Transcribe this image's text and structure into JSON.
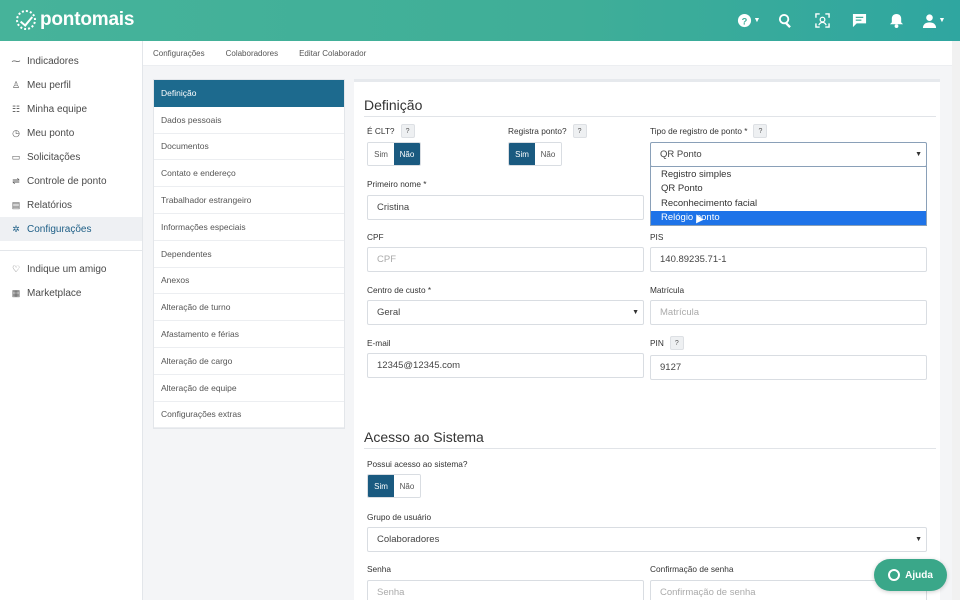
{
  "brand": {
    "name": "pontomais"
  },
  "topbar": {
    "icons": [
      "help-icon",
      "search-icon",
      "face-scan-icon",
      "chat-icon",
      "bell-icon",
      "user-icon"
    ]
  },
  "sidebar": {
    "items": [
      {
        "label": "Indicadores",
        "icon": "chart-icon"
      },
      {
        "label": "Meu perfil",
        "icon": "user-icon"
      },
      {
        "label": "Minha equipe",
        "icon": "team-icon"
      },
      {
        "label": "Meu ponto",
        "icon": "clock-icon"
      },
      {
        "label": "Solicitações",
        "icon": "message-icon"
      },
      {
        "label": "Controle de ponto",
        "icon": "control-icon"
      },
      {
        "label": "Relatórios",
        "icon": "report-icon"
      },
      {
        "label": "Configurações",
        "icon": "gear-icon",
        "active": true
      }
    ],
    "extra": [
      {
        "label": "Indique um amigo",
        "icon": "heart-icon"
      },
      {
        "label": "Marketplace",
        "icon": "store-icon"
      }
    ]
  },
  "breadcrumb": [
    "Configurações",
    "Colaboradores",
    "Editar Colaborador"
  ],
  "submenu": [
    "Definição",
    "Dados pessoais",
    "Documentos",
    "Contato e endereço",
    "Trabalhador estrangeiro",
    "Informações especiais",
    "Dependentes",
    "Anexos",
    "Alteração de turno",
    "Afastamento e férias",
    "Alteração de cargo",
    "Alteração de equipe",
    "Configurações extras"
  ],
  "definicao": {
    "title": "Definição",
    "clt": {
      "label": "É CLT?",
      "help": "?",
      "sim": "Sim",
      "nao": "Não",
      "selected": "Não"
    },
    "registra": {
      "label": "Registra ponto?",
      "help": "?",
      "sim": "Sim",
      "nao": "Não",
      "selected": "Sim"
    },
    "tipo": {
      "label": "Tipo de registro de ponto *",
      "help": "?",
      "value": "QR Ponto",
      "options": [
        "Registro simples",
        "QR Ponto",
        "Reconhecimento facial",
        "Relógio ponto"
      ],
      "highlighted": "Relógio ponto"
    },
    "primeiro_nome": {
      "label": "Primeiro nome *",
      "value": "Cristina"
    },
    "cpf": {
      "label": "CPF",
      "placeholder": "CPF"
    },
    "pis": {
      "label": "PIS",
      "value": "140.89235.71-1"
    },
    "centro_custo": {
      "label": "Centro de custo *",
      "value": "Geral"
    },
    "matricula": {
      "label": "Matrícula",
      "placeholder": "Matrícula"
    },
    "email": {
      "label": "E-mail",
      "value": "12345@12345.com"
    },
    "pin": {
      "label": "PIN",
      "help": "?",
      "value": "9127"
    }
  },
  "acesso": {
    "title": "Acesso ao Sistema",
    "possui": {
      "label": "Possui acesso ao sistema?",
      "sim": "Sim",
      "nao": "Não",
      "selected": "Sim"
    },
    "grupo": {
      "label": "Grupo de usuário",
      "value": "Colaboradores"
    },
    "senha": {
      "label": "Senha",
      "placeholder": "Senha"
    },
    "confirmacao": {
      "label": "Confirmação de senha",
      "placeholder": "Confirmação de senha"
    }
  },
  "help_button": {
    "label": "Ajuda"
  },
  "colors": {
    "brand_green": "#3fae98",
    "active_blue": "#1a5a80",
    "selected_option": "#1e73e8"
  }
}
